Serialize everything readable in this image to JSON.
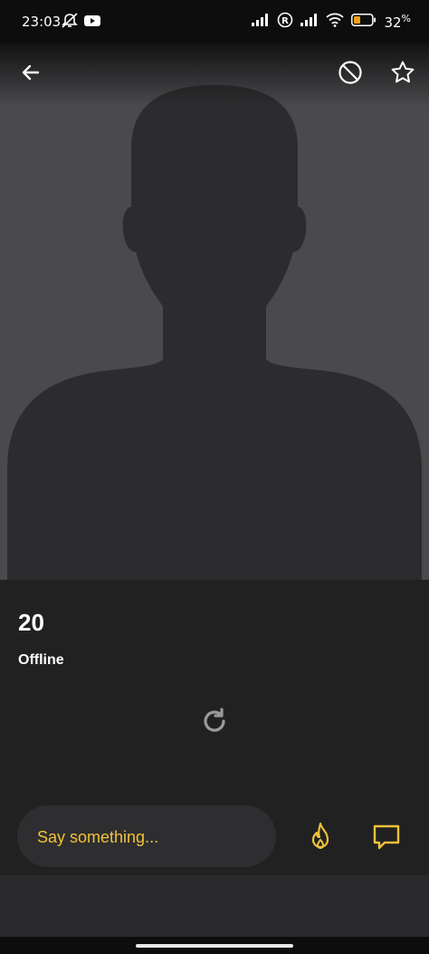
{
  "status_bar": {
    "time": "23:03",
    "battery_percent": "32",
    "battery_unit": "%",
    "icons": [
      "notification-muted-icon",
      "youtube-icon",
      "signal-icon",
      "roaming-icon",
      "signal-icon",
      "wifi-icon",
      "battery-icon"
    ]
  },
  "header": {
    "back_icon": "arrow-left-icon",
    "block_icon": "block-icon",
    "favorite_icon": "star-outline-icon"
  },
  "profile": {
    "age": "20",
    "status": "Offline"
  },
  "composer": {
    "placeholder": "Say something...",
    "tap_icon": "flame-icon",
    "chat_icon": "chat-bubble-icon"
  },
  "colors": {
    "accent": "#f0c23a",
    "panel": "#212122",
    "photo_bg": "#4a4a4d"
  }
}
